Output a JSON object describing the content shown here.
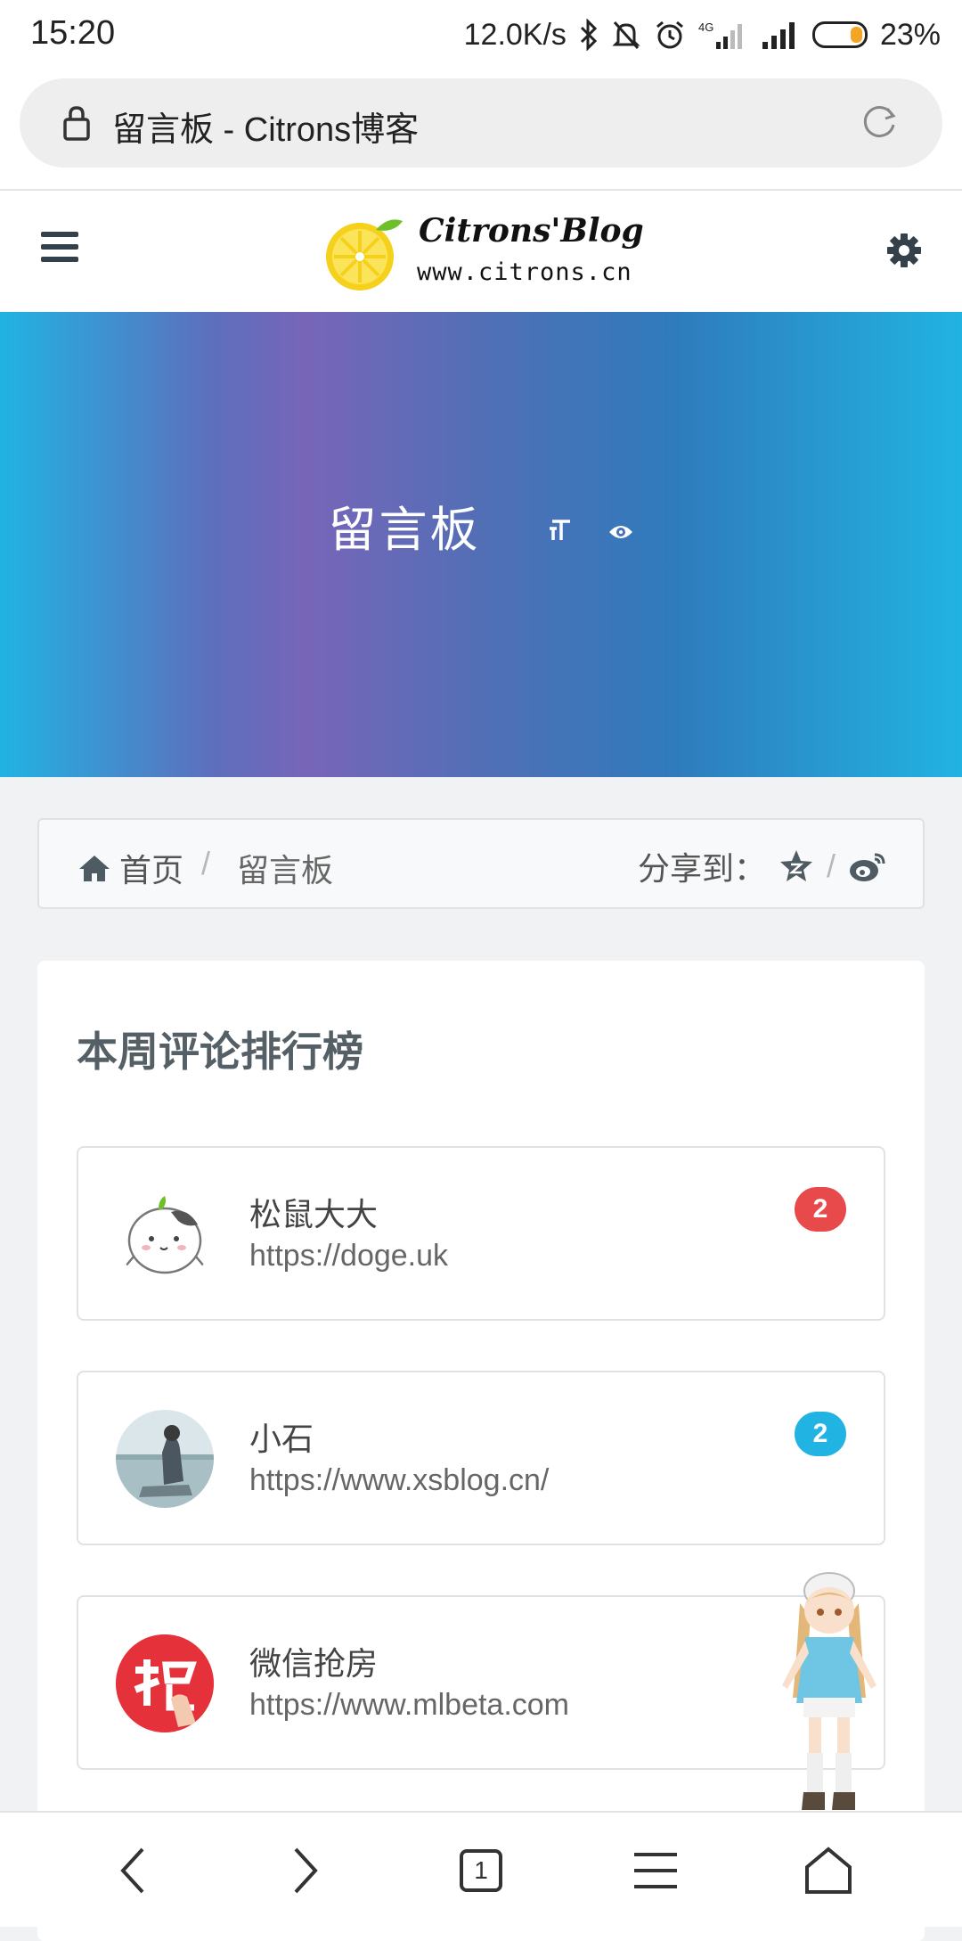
{
  "status_bar": {
    "time": "15:20",
    "net_speed": "12.0K/s",
    "network": "4G",
    "battery": "23%",
    "battery_level": 0.23,
    "battery_color": "#f3a623"
  },
  "browser": {
    "url_title": "留言板 - Citrons博客",
    "tab_count": "1"
  },
  "site": {
    "logo_line1": "Citrons'Blog",
    "logo_line2": "www.citrons.cn"
  },
  "hero": {
    "title": "留言板",
    "gradient_colors": [
      "#21b3e2",
      "#7765b8",
      "#2f7bbc"
    ]
  },
  "breadcrumb": {
    "home": "首页",
    "current": "留言板",
    "share_label": "分享到："
  },
  "ranking": {
    "title": "本周评论排行榜",
    "items": [
      {
        "name": "松鼠大大",
        "url": "https://doge.uk",
        "count": "2",
        "badge_color": "#e8494b"
      },
      {
        "name": "小石",
        "url": "https://www.xsblog.cn/",
        "count": "2",
        "badge_color": "#21b3e2"
      },
      {
        "name": "微信抢房",
        "url": "https://www.mlbeta.com",
        "count": "",
        "badge_color": ""
      }
    ]
  },
  "icons": {
    "menu": "hamburger-icon",
    "settings": "gear-icon",
    "font": "font-size-icon",
    "views": "eye-icon",
    "home": "home-icon",
    "qzone": "star-icon",
    "weibo": "weibo-icon"
  }
}
